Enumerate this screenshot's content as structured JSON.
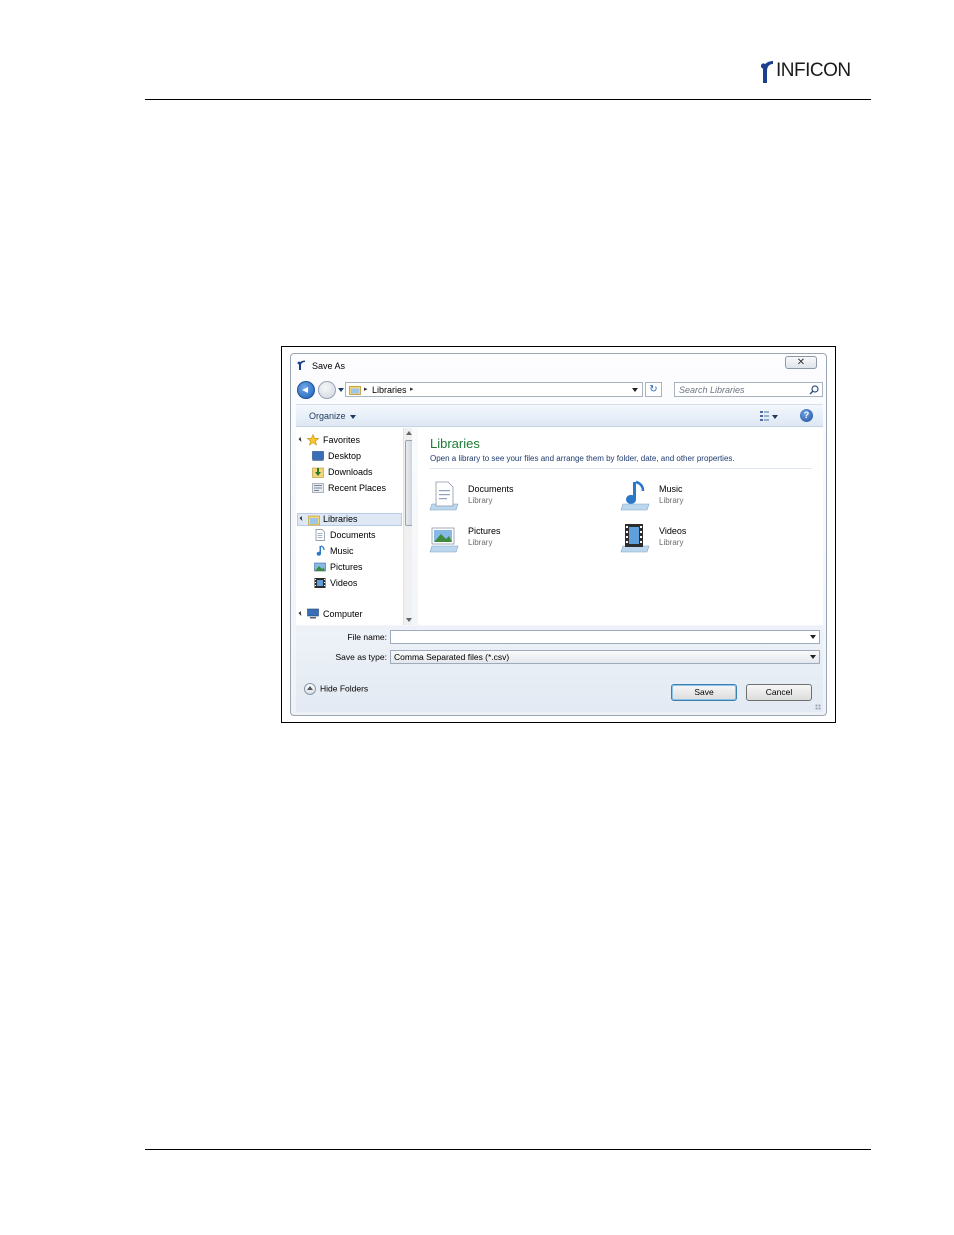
{
  "brand": {
    "logo_text": "INFICON"
  },
  "dialog": {
    "title": "Save As",
    "close_glyph": "✕",
    "address": {
      "breadcrumb": [
        "Libraries"
      ],
      "separator": "▸"
    },
    "search_placeholder": "Search Libraries",
    "toolbar": {
      "organize_label": "Organize",
      "help_glyph": "?"
    },
    "nav": {
      "favorites": {
        "label": "Favorites",
        "items": [
          "Desktop",
          "Downloads",
          "Recent Places"
        ]
      },
      "libraries": {
        "label": "Libraries",
        "items": [
          "Documents",
          "Music",
          "Pictures",
          "Videos"
        ]
      },
      "computer": {
        "label": "Computer"
      }
    },
    "content": {
      "title": "Libraries",
      "subtitle": "Open a library to see your files and arrange them by folder, date, and other properties.",
      "libraries": [
        {
          "name": "Documents",
          "kind": "Library",
          "icon": "documents-library-icon"
        },
        {
          "name": "Music",
          "kind": "Library",
          "icon": "music-library-icon"
        },
        {
          "name": "Pictures",
          "kind": "Library",
          "icon": "pictures-library-icon"
        },
        {
          "name": "Videos",
          "kind": "Library",
          "icon": "videos-library-icon"
        }
      ]
    },
    "footer": {
      "file_name_label": "File name:",
      "file_name_value": "",
      "save_type_label": "Save as type:",
      "save_type_value": "Comma Separated files (*.csv)",
      "hide_folders_label": "Hide Folders",
      "save_label": "Save",
      "cancel_label": "Cancel"
    }
  },
  "colors": {
    "accent": "#1e7b33",
    "link": "#1e3b70",
    "selection": "#dfe9f6"
  }
}
